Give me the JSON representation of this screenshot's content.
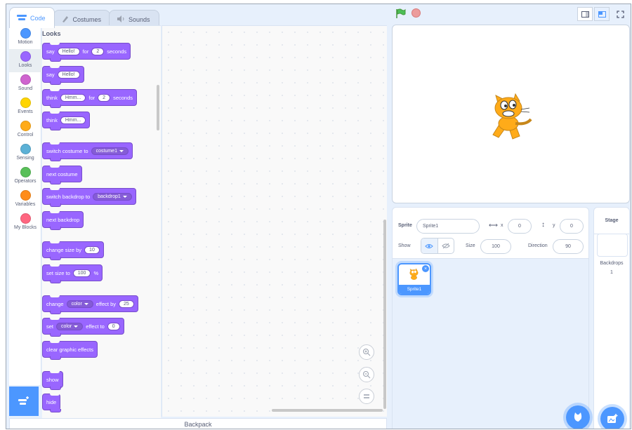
{
  "tabs": [
    {
      "label": "Code",
      "icon": "code-icon"
    },
    {
      "label": "Costumes",
      "icon": "brush-icon"
    },
    {
      "label": "Sounds",
      "icon": "speaker-icon"
    }
  ],
  "categories": [
    {
      "label": "Motion",
      "color": "#4c97ff"
    },
    {
      "label": "Looks",
      "color": "#9966ff"
    },
    {
      "label": "Sound",
      "color": "#cf63cf"
    },
    {
      "label": "Events",
      "color": "#ffd500"
    },
    {
      "label": "Control",
      "color": "#ffab19"
    },
    {
      "label": "Sensing",
      "color": "#5cb1d6"
    },
    {
      "label": "Operators",
      "color": "#59c059"
    },
    {
      "label": "Variables",
      "color": "#ff8c1a"
    },
    {
      "label": "My Blocks",
      "color": "#ff6680"
    }
  ],
  "palette": {
    "title": "Looks",
    "say_secs": {
      "say": "say",
      "msg": "Hello!",
      "for": "for",
      "secs": "2",
      "seconds": "seconds"
    },
    "say": {
      "say": "say",
      "msg": "Hello!"
    },
    "think_secs": {
      "think": "think",
      "msg": "Hmm...",
      "for": "for",
      "secs": "2",
      "seconds": "seconds"
    },
    "think": {
      "think": "think",
      "msg": "Hmm..."
    },
    "switch_costume": {
      "text": "switch costume to",
      "value": "costume1"
    },
    "next_costume": "next costume",
    "switch_backdrop": {
      "text": "switch backdrop to",
      "value": "backdrop1"
    },
    "next_backdrop": "next backdrop",
    "change_size": {
      "text": "change size by",
      "value": "10"
    },
    "set_size": {
      "text": "set size to",
      "value": "100",
      "unit": "%"
    },
    "change_effect": {
      "change": "change",
      "effect": "color",
      "by": "effect by",
      "value": "25"
    },
    "set_effect": {
      "set": "set",
      "effect": "color",
      "to": "effect to",
      "value": "0"
    },
    "clear_effects": "clear graphic effects",
    "show": "show",
    "hide": "hide"
  },
  "backpack": "Backpack",
  "sprite_info": {
    "sprite_label": "Sprite",
    "sprite_name": "Sprite1",
    "x_label": "x",
    "x_value": "0",
    "y_label": "y",
    "y_value": "0",
    "show_label": "Show",
    "size_label": "Size",
    "size_value": "100",
    "direction_label": "Direction",
    "direction_value": "90"
  },
  "sprites": [
    {
      "name": "Sprite1"
    }
  ],
  "stage_panel": {
    "title": "Stage",
    "backdrops_label": "Backdrops",
    "backdrops_count": "1"
  },
  "colors": {
    "accent": "#4c97ff",
    "looks": "#9966ff"
  }
}
